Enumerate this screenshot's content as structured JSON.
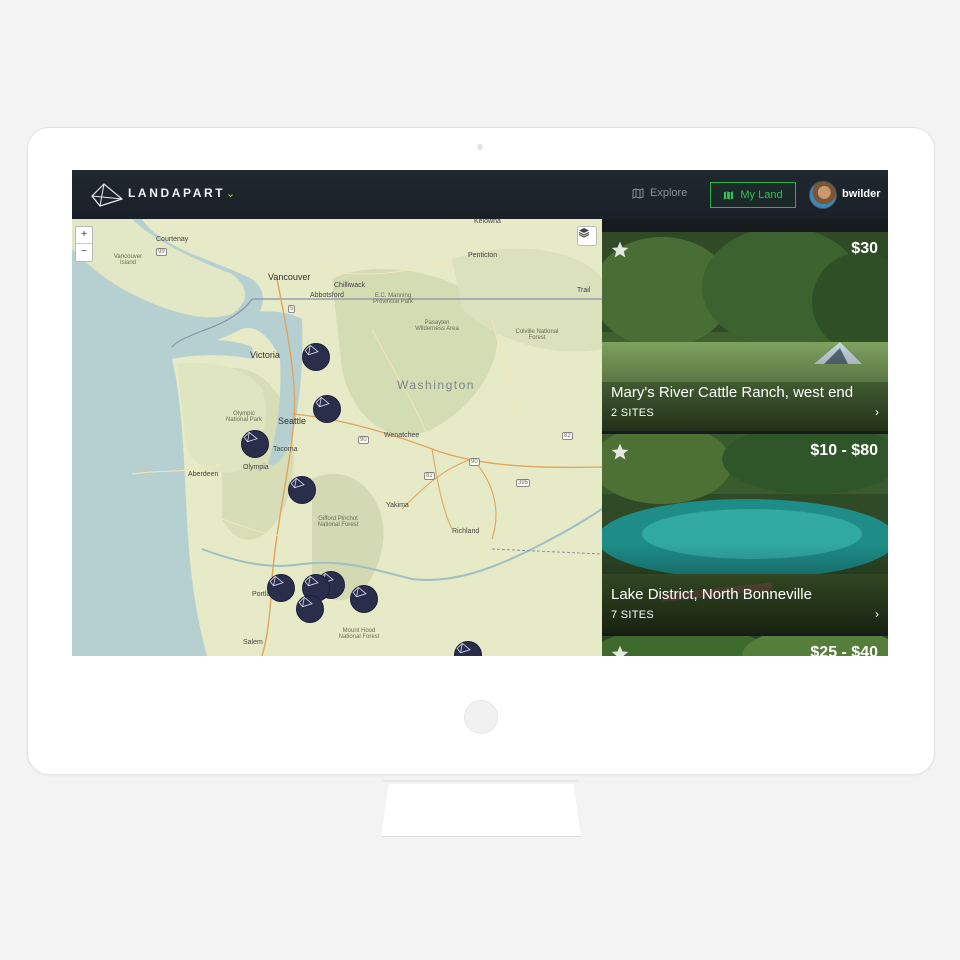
{
  "header": {
    "brand": "LandApart",
    "brand_caret": "⌄",
    "nav_explore": "Explore",
    "nav_my_land": "My Land",
    "username": "bwilder"
  },
  "map": {
    "zoom_in": "+",
    "zoom_out": "−",
    "labels": {
      "courtenay": "Courtenay",
      "vancouver_island": "Vancouver Island",
      "vancouver": "Vancouver",
      "chilliwack": "Chilliwack",
      "abbotsford": "Abbotsford",
      "kelowna": "Kelowna",
      "penticton": "Penticton",
      "ec_manning": "E.C. Manning Provincial Park",
      "pasayten": "Pasayten Wilderness Area",
      "colville": "Colville National Forest",
      "trail": "Trail",
      "victoria": "Victoria",
      "washington": "Washington",
      "olympic": "Olympic National Park",
      "seattle": "Seattle",
      "wenatchee": "Wenatchee",
      "tacoma": "Tacoma",
      "olympia": "Olympia",
      "aberdeen": "Aberdeen",
      "yakima": "Yakima",
      "richland": "Richland",
      "gifford": "Gifford Pinchot National Forest",
      "portland": "Portland",
      "mount_hood": "Mount Hood National Forest",
      "salem": "Salem",
      "var": "Van"
    },
    "shields": [
      "99",
      "5",
      "90",
      "90",
      "82",
      "395",
      "82"
    ]
  },
  "listings": [
    {
      "price": "$30",
      "title": "Mary's River Cattle Ranch, west end",
      "sites": "2 SITES"
    },
    {
      "price": "$10 - $80",
      "title": "Lake District, North Bonneville",
      "sites": "7 SITES"
    },
    {
      "price": "$25 - $40",
      "title": "",
      "sites": ""
    }
  ],
  "colors": {
    "header_bg": "#1d232b",
    "accent_green": "#33c152",
    "brand_caret": "#b8d43a",
    "marker": "#2a2e4a"
  },
  "icons": [
    "landapart-logo-icon",
    "map-icon",
    "map-green-icon",
    "layers-icon",
    "star-icon",
    "chevron-right-icon",
    "campsite-marker-icon"
  ]
}
